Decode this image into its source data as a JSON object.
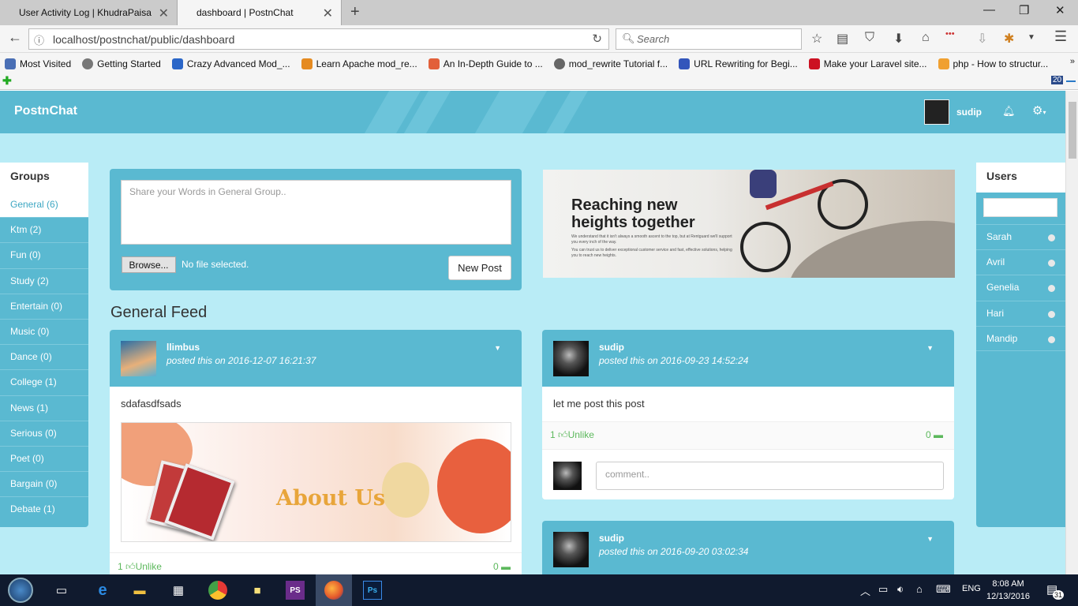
{
  "browser": {
    "tabs": [
      {
        "title": "User Activity Log | KhudraPaisa"
      },
      {
        "title": "dashboard | PostnChat"
      }
    ],
    "url": "localhost/postnchat/public/dashboard",
    "search_placeholder": "Search",
    "bookmarks": [
      {
        "label": "Most Visited",
        "color": "#4a6fb5"
      },
      {
        "label": "Getting Started",
        "color": "#777777"
      },
      {
        "label": "Crazy Advanced Mod_...",
        "color": "#2a66c8"
      },
      {
        "label": "Learn Apache mod_re...",
        "color": "#e58a20"
      },
      {
        "label": "An In-Depth Guide to ...",
        "color": "#e2603a"
      },
      {
        "label": "mod_rewrite Tutorial f...",
        "color": "#666666"
      },
      {
        "label": "URL Rewriting for Begi...",
        "color": "#3355bb"
      },
      {
        "label": "Make your Laravel site...",
        "color": "#cc1122"
      },
      {
        "label": "php - How to structur...",
        "color": "#f0a030"
      }
    ],
    "addon_badge": "20"
  },
  "app": {
    "brand": "PostnChat",
    "username": "sudip"
  },
  "groups": {
    "title": "Groups",
    "items": [
      {
        "label": "General (6)"
      },
      {
        "label": "Ktm (2)"
      },
      {
        "label": "Fun (0)"
      },
      {
        "label": "Study (2)"
      },
      {
        "label": "Entertain (0)"
      },
      {
        "label": "Music (0)"
      },
      {
        "label": "Dance (0)"
      },
      {
        "label": "College (1)"
      },
      {
        "label": "News (1)"
      },
      {
        "label": "Serious (0)"
      },
      {
        "label": "Poet (0)"
      },
      {
        "label": "Bargain (0)"
      },
      {
        "label": "Debate (1)"
      }
    ]
  },
  "users": {
    "title": "Users",
    "items": [
      {
        "name": "Sarah"
      },
      {
        "name": "Avril"
      },
      {
        "name": "Genelia"
      },
      {
        "name": "Hari"
      },
      {
        "name": "Mandip"
      }
    ]
  },
  "composer": {
    "placeholder": "Share your Words in General Group..",
    "browse_label": "Browse...",
    "file_status": "No file selected.",
    "submit_label": "New Post"
  },
  "banner": {
    "headline_1": "Reaching new",
    "headline_2": "heights together",
    "body_1": "We understand that it isn't always a smooth ascent to the top, but at Rentguard we'll support you every inch of the way.",
    "body_2": "You can trust us to deliver exceptional customer service and fast, effective solutions, helping you to reach new heights."
  },
  "feed": {
    "title": "General Feed",
    "posts": [
      {
        "author": "llimbus",
        "date": "posted this on 2016-12-07 16:21:37",
        "body": "sdafasdfsads",
        "image_text": "About Us",
        "likes": "1",
        "like_label": "Unlike",
        "comments": "0"
      },
      {
        "author": "sudip",
        "date": "posted this on 2016-09-23 14:52:24",
        "body": "let me post this post",
        "likes": "1",
        "like_label": "Unlike",
        "comments": "0",
        "comment_placeholder": "comment.."
      },
      {
        "author": "sudip",
        "date": "posted this on 2016-09-20 03:02:34"
      }
    ]
  },
  "taskbar": {
    "lang": "ENG",
    "time": "8:08 AM",
    "date": "12/13/2016",
    "notification_count": "31"
  },
  "colors": {
    "primary": "#5ab9d1",
    "page_bg": "#b9ecf6",
    "like_green": "#5cb85c"
  }
}
